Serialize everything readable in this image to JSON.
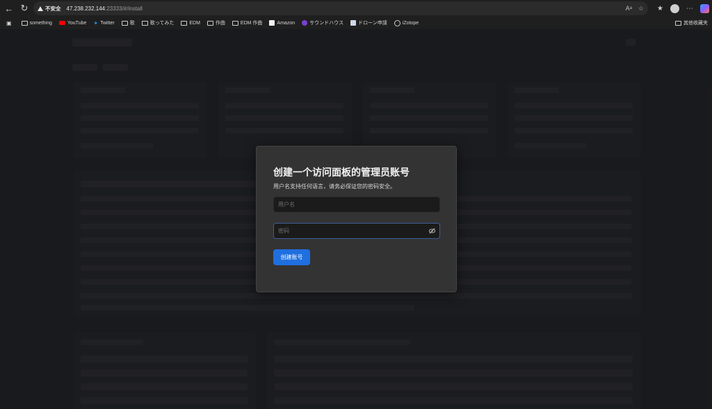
{
  "browser": {
    "security_label": "不安全",
    "url_host": "47.238.232.144",
    "url_rest": ":23333/#/install"
  },
  "bookmarks": {
    "items": [
      "something",
      "YouTube",
      "Twitter",
      "歌",
      "歌ってみた",
      "EDM",
      "作曲",
      "EDM 作曲",
      "Amazon",
      "サウンドハウス",
      "ドローン申請",
      "iZotope"
    ],
    "other": "其他收藏夹"
  },
  "modal": {
    "title": "创建一个访问面板的管理员账号",
    "description": "用户名支持任何语言，请务必保证您的密码安全。",
    "username_placeholder": "用户名",
    "password_placeholder": "密码",
    "submit_label": "创建账号"
  }
}
